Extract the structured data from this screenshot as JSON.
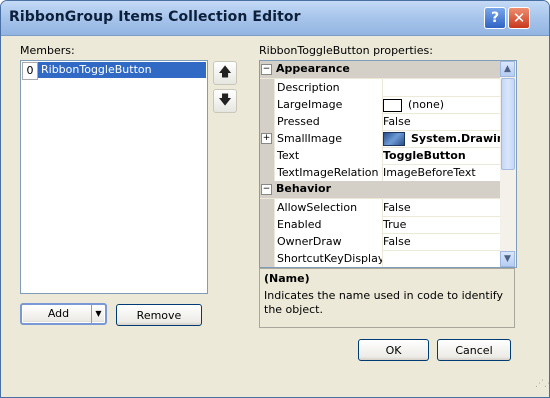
{
  "window": {
    "title": "RibbonGroup Items Collection Editor"
  },
  "titlebar": {
    "help_icon": "?",
    "close_icon": "✕"
  },
  "members": {
    "label": "Members:",
    "items": [
      {
        "index": "0",
        "name": "RibbonToggleButton"
      }
    ],
    "up_icon": "🡅",
    "down_icon": "🡇"
  },
  "properties": {
    "label": "RibbonToggleButton properties:",
    "categories": [
      {
        "name": "Appearance",
        "rows": [
          {
            "name": "Description",
            "value": ""
          },
          {
            "name": "LargeImage",
            "value": "(none)"
          },
          {
            "name": "Pressed",
            "value": "False"
          },
          {
            "name": "SmallImage",
            "value": "System.Drawing"
          },
          {
            "name": "Text",
            "value": "ToggleButton"
          },
          {
            "name": "TextImageRelation",
            "value": "ImageBeforeText"
          }
        ]
      },
      {
        "name": "Behavior",
        "rows": [
          {
            "name": "AllowSelection",
            "value": "False"
          },
          {
            "name": "Enabled",
            "value": "True"
          },
          {
            "name": "OwnerDraw",
            "value": "False"
          },
          {
            "name": "ShortcutKeyDisplaySt",
            "value": ""
          }
        ]
      }
    ],
    "collapse_icon": "−",
    "expand_icon": "+"
  },
  "description": {
    "title": "(Name)",
    "text": "Indicates the name used in code to identify the object."
  },
  "buttons": {
    "add": "Add",
    "add_dropdown": "▼",
    "remove": "Remove",
    "ok": "OK",
    "cancel": "Cancel"
  }
}
